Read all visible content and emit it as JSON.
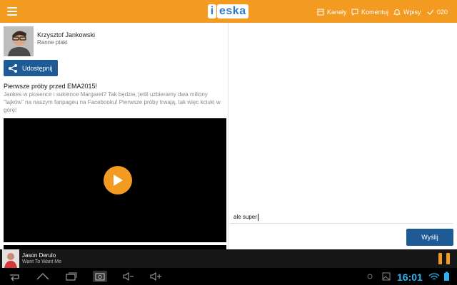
{
  "theme": {
    "accent": "#f39a21",
    "button_blue": "#1d5a96",
    "logo_blue": "#2f78c7"
  },
  "header": {
    "logo_i": "i",
    "logo_text": "eska",
    "menu_icon": "hamburger-menu-icon",
    "actions": [
      {
        "label": "Kanały",
        "icon": "channels-icon"
      },
      {
        "label": "Komentuj",
        "icon": "comment-icon"
      },
      {
        "label": "Wpisy",
        "icon": "bell-icon"
      },
      {
        "label": "020",
        "icon": "checkmark-icon"
      }
    ]
  },
  "post": {
    "author": "Krzysztof Jankowski",
    "show": "Ranne ptaki",
    "share_label": "Udostępnij",
    "title": "Pierwsze próby przed EMA2015!",
    "body": "Jankes w piosence i sukience Margaret? Tak będzie, jeśli uzbieramy dwa miliony \"lajków\" na naszym fanpageu na Facebooku! Pierwsze próby trwają, tak więc kciuki w górę!"
  },
  "comment": {
    "value": "ale super",
    "send_label": "Wyślij"
  },
  "now_playing": {
    "artist": "Jason Derulo",
    "title": "Want To Want Me"
  },
  "system": {
    "clock": "16:01"
  }
}
